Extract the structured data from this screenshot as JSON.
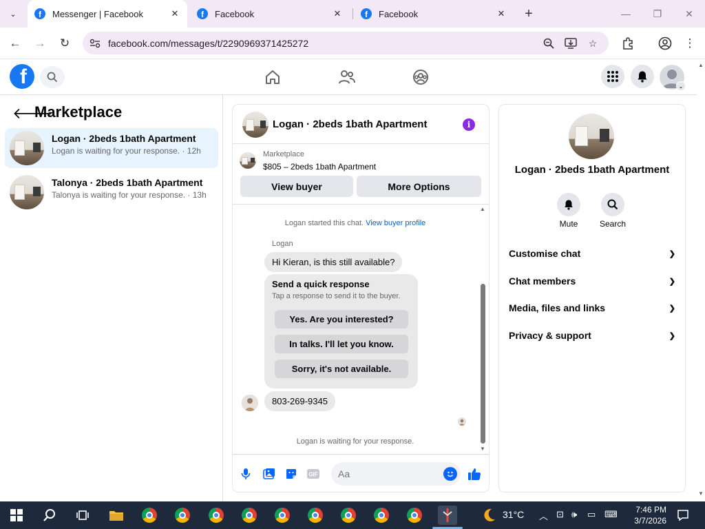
{
  "browser": {
    "tabs": [
      {
        "title": "Messenger | Facebook"
      },
      {
        "title": "Facebook"
      },
      {
        "title": "Facebook"
      }
    ],
    "url": "facebook.com/messages/t/2290969371425272"
  },
  "left_panel": {
    "title": "Marketplace",
    "conversations": [
      {
        "name": "Logan · 2beds 1bath Apartment",
        "preview": "Logan is waiting for your response. · 12h"
      },
      {
        "name": "Talonya · 2beds 1bath Apartment",
        "preview": "Talonya is waiting for your response. · 13h"
      }
    ]
  },
  "chat": {
    "title": "Logan · 2beds 1bath Apartment",
    "listing_source": "Marketplace",
    "listing_title": "$805 – 2beds 1bath Apartment",
    "view_buyer": "View buyer",
    "more_options": "More Options",
    "started_text": "Logan started this chat.",
    "view_buyer_profile": "View buyer profile",
    "sender_name": "Logan",
    "message_1": "Hi Kieran, is this still available?",
    "quick_title": "Send a quick response",
    "quick_subtitle": "Tap a response to send it to the buyer.",
    "quick_options": [
      "Yes. Are you interested?",
      "In talks. I'll let you know.",
      "Sorry, it's not available."
    ],
    "message_2": "803-269-9345",
    "waiting_text": "Logan is waiting for your response.",
    "input_placeholder": "Aa"
  },
  "right_panel": {
    "name": "Logan · 2beds 1bath Apartment",
    "actions": [
      {
        "label": "Mute",
        "icon": "bell-icon"
      },
      {
        "label": "Search",
        "icon": "search-icon"
      }
    ],
    "sections": [
      "Customise chat",
      "Chat members",
      "Media, files and links",
      "Privacy & support"
    ]
  },
  "taskbar": {
    "weather": "31°C",
    "time": "7:46 PM",
    "date": "3/7/2026"
  },
  "colors": {
    "brand": "#1877f2",
    "messenger_accent": "#0866ff",
    "info_icon": "#8a2be2",
    "active_row": "#e7f3ff"
  }
}
